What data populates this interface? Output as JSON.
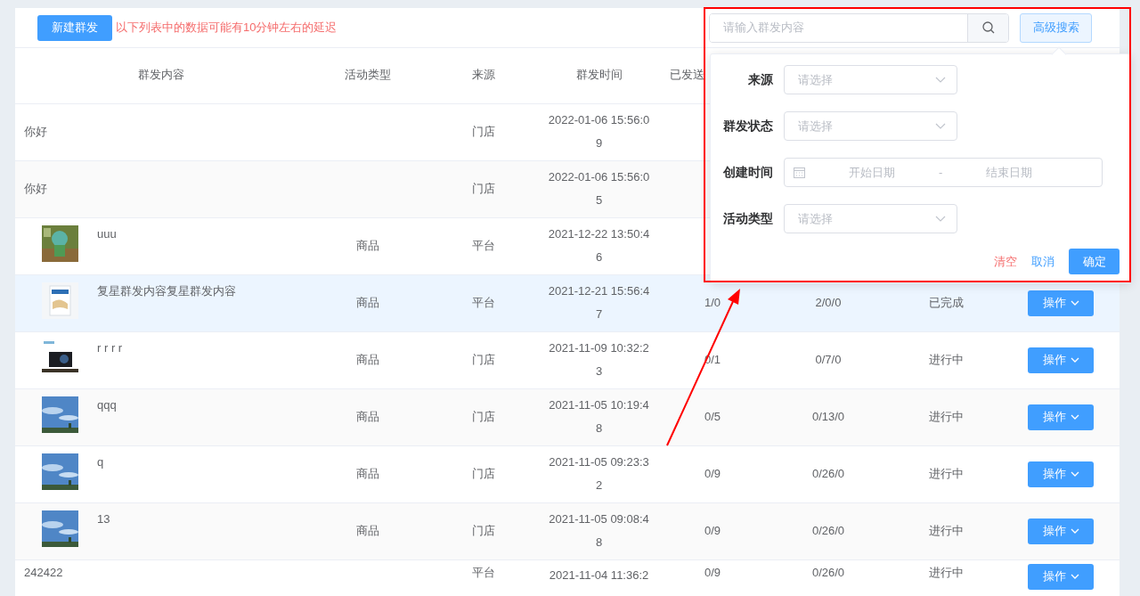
{
  "toolbar": {
    "new_button": "新建群发",
    "notice": "以下列表中的数据可能有10分钟左右的延迟"
  },
  "search": {
    "placeholder": "请输入群发内容",
    "advanced_button": "高级搜索"
  },
  "table": {
    "columns": [
      "群发内容",
      "活动类型",
      "来源",
      "群发时间",
      "已发送"
    ],
    "rows": [
      {
        "kind": "text",
        "hovered": false,
        "content": "你好",
        "source": "门店",
        "time": "2022-01-06 15:56:09"
      },
      {
        "kind": "text",
        "hovered": false,
        "content": "你好",
        "source": "门店",
        "time": "2022-01-06 15:56:05"
      },
      {
        "kind": "picture",
        "hovered": false,
        "content": "uuu",
        "activity_type": "商品",
        "source": "平台",
        "time": "2021-12-22 13:50:46"
      },
      {
        "kind": "picture",
        "hovered": true,
        "content": "复星群发内容复星群发内容",
        "activity_type": "商品",
        "source": "平台",
        "time": "2021-12-21 15:56:47",
        "sent": "1/0",
        "column_6": "2/0/0",
        "status": "已完成",
        "action": "操作"
      },
      {
        "kind": "picture",
        "hovered": false,
        "content": "r r r r",
        "activity_type": "商品",
        "source": "门店",
        "time": "2021-11-09 10:32:23",
        "sent": "0/1",
        "column_6": "0/7/0",
        "status": "进行中",
        "action": "操作"
      },
      {
        "kind": "picture",
        "hovered": false,
        "content": "qqq",
        "activity_type": "商品",
        "source": "门店",
        "time": "2021-11-05 10:19:48",
        "sent": "0/5",
        "column_6": "0/13/0",
        "status": "进行中",
        "action": "操作"
      },
      {
        "kind": "picture",
        "hovered": false,
        "content": "q",
        "activity_type": "商品",
        "source": "门店",
        "time": "2021-11-05 09:23:32",
        "sent": "0/9",
        "column_6": "0/26/0",
        "status": "进行中",
        "action": "操作"
      },
      {
        "kind": "picture",
        "hovered": false,
        "content": "13",
        "activity_type": "商品",
        "source": "门店",
        "time": "2021-11-05 09:08:48",
        "sent": "0/9",
        "column_6": "0/26/0",
        "status": "进行中",
        "action": "操作"
      },
      {
        "kind": "text",
        "hovered": false,
        "content": "242422",
        "source": "平台",
        "time": "2021-11-04 11:36:2",
        "sent": "0/9",
        "column_6": "0/26/0",
        "status": "进行中",
        "action": "操作"
      }
    ]
  },
  "advanced_search": {
    "fields": [
      {
        "kind": "select",
        "label": "来源",
        "placeholder": "请选择"
      },
      {
        "kind": "select",
        "label": "群发状态",
        "placeholder": "请选择"
      },
      {
        "kind": "daterange",
        "label": "创建时间",
        "start_placeholder": "开始日期",
        "separator": "-",
        "end_placeholder": "结束日期"
      },
      {
        "kind": "select",
        "label": "活动类型",
        "placeholder": "请选择"
      }
    ],
    "clear": "清空",
    "cancel": "取消",
    "confirm": "确定"
  }
}
